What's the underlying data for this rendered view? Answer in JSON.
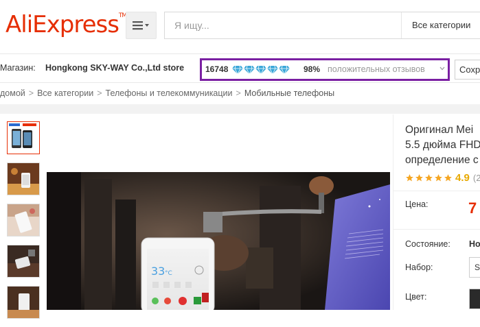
{
  "header": {
    "logo_text": "AliExpress",
    "logo_tm": "TM",
    "search_placeholder": "Я ищу...",
    "search_category": "Все категории"
  },
  "store": {
    "label": "Магазин:",
    "name": "Hongkong SKY-WAY Co.,Ltd store",
    "score": "16748",
    "diamonds": 5,
    "positive_pct": "98%",
    "positive_text": "положительных отзывов",
    "save_label": "Сохр"
  },
  "breadcrumb": {
    "items": [
      "домой",
      "Все категории",
      "Телефоны и телекоммуникации",
      "Мобильные телефоны"
    ]
  },
  "product": {
    "title_lines": [
      "Оригинал Mei",
      "5.5 дюйма FHD",
      "определение с"
    ],
    "rating": "4.9",
    "reviews_partial": "(2",
    "price_label": "Цена:",
    "price_partial": "7",
    "condition_label": "Состояние:",
    "condition_value": "Но",
    "set_label": "Набор:",
    "set_value": "S",
    "color_label": "Цвет:",
    "phone_clock": "33",
    "phone_temp": "°C"
  },
  "colors": {
    "brand": "#e62e04",
    "highlight_border": "#7a1fa2",
    "diamond": "#3aa6d8",
    "star": "#f5a623"
  }
}
